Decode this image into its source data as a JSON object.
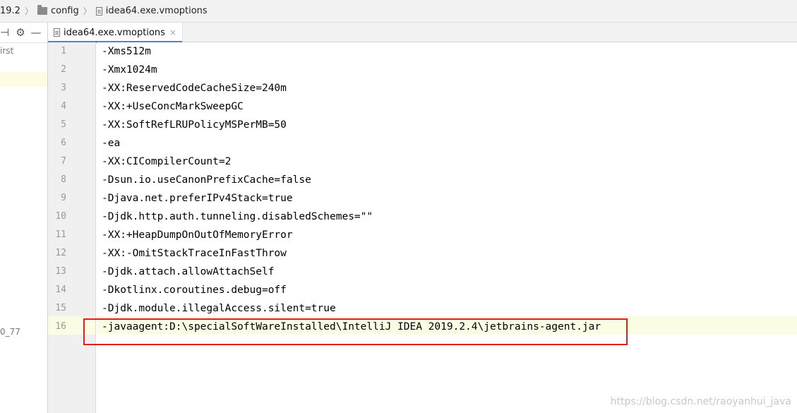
{
  "breadcrumb": {
    "items": [
      {
        "label": "19.2",
        "icon": "none"
      },
      {
        "label": "config",
        "icon": "folder-icon"
      },
      {
        "label": "idea64.exe.vmoptions",
        "icon": "file-icon"
      }
    ]
  },
  "left_panel": {
    "toolbar_icons": [
      "gear-icon",
      "minimize-icon"
    ],
    "rows": [
      {
        "label": "irst"
      },
      {
        "label": "0_77"
      }
    ]
  },
  "tabs": [
    {
      "label": "idea64.exe.vmoptions",
      "close": "×",
      "active": true
    }
  ],
  "editor": {
    "current_line": 16,
    "lines": [
      {
        "num": "1",
        "text": "-Xms512m"
      },
      {
        "num": "2",
        "text": "-Xmx1024m"
      },
      {
        "num": "3",
        "text": "-XX:ReservedCodeCacheSize=240m"
      },
      {
        "num": "4",
        "text": "-XX:+UseConcMarkSweepGC"
      },
      {
        "num": "5",
        "text": "-XX:SoftRefLRUPolicyMSPerMB=50"
      },
      {
        "num": "6",
        "text": "-ea"
      },
      {
        "num": "7",
        "text": "-XX:CICompilerCount=2"
      },
      {
        "num": "8",
        "text": "-Dsun.io.useCanonPrefixCache=false"
      },
      {
        "num": "9",
        "text": "-Djava.net.preferIPv4Stack=true"
      },
      {
        "num": "10",
        "text": "-Djdk.http.auth.tunneling.disabledSchemes=\"\""
      },
      {
        "num": "11",
        "text": "-XX:+HeapDumpOnOutOfMemoryError"
      },
      {
        "num": "12",
        "text": "-XX:-OmitStackTraceInFastThrow"
      },
      {
        "num": "13",
        "text": "-Djdk.attach.allowAttachSelf"
      },
      {
        "num": "14",
        "text": "-Dkotlinx.coroutines.debug=off"
      },
      {
        "num": "15",
        "text": "-Djdk.module.illegalAccess.silent=true"
      },
      {
        "num": "16",
        "text": "-javaagent:D:\\specialSoftWareInstalled\\IntelliJ IDEA 2019.2.4\\jetbrains-agent.jar"
      }
    ]
  },
  "watermark": "https://blog.csdn.net/raoyanhui_java",
  "colors": {
    "highlight_box": "#e0201c",
    "current_line_bg": "#fcfbe3",
    "tab_underline": "#4a88c7"
  }
}
